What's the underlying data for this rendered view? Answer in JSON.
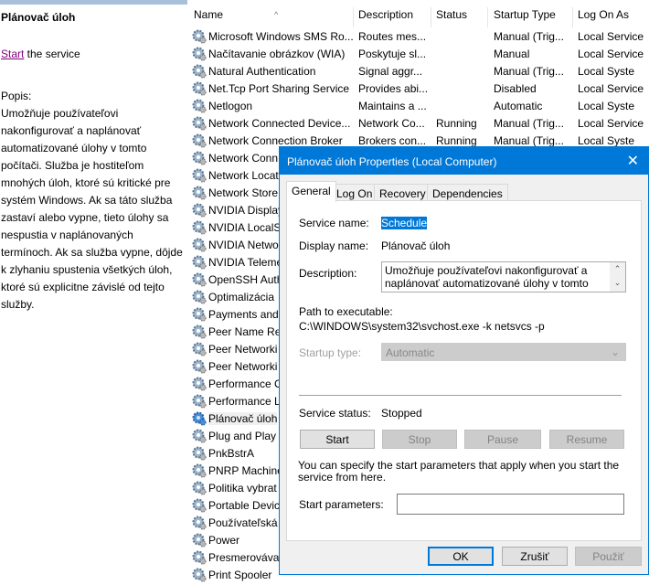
{
  "left_pane": {
    "title": "Plánovač úloh",
    "start_link": "Start",
    "start_rest": " the service",
    "popis_label": "Popis:",
    "description": "Umožňuje používateľovi nakonfigurovať a naplánovať automatizované úlohy v tomto počítači. Služba je hostiteľom mnohých úloh, ktoré sú kritické pre systém Windows. Ak sa táto služba zastaví alebo vypne, tieto úlohy sa nespustia v naplánovaných termínoch. Ak sa služba vypne, dôjde k zlyhaniu spustenia všetkých úloh, ktoré sú explicitne závislé od tejto služby."
  },
  "columns": [
    "Name",
    "Description",
    "Status",
    "Startup Type",
    "Log On As"
  ],
  "services": [
    {
      "name": "Microsoft Windows SMS Ro...",
      "desc": "Routes mes...",
      "status": "",
      "startup": "Manual (Trig...",
      "logon": "Local Service"
    },
    {
      "name": "Načítavanie obrázkov (WIA)",
      "desc": "Poskytuje sl...",
      "status": "",
      "startup": "Manual",
      "logon": "Local Service"
    },
    {
      "name": "Natural Authentication",
      "desc": "Signal aggr...",
      "status": "",
      "startup": "Manual (Trig...",
      "logon": "Local Syste"
    },
    {
      "name": "Net.Tcp Port Sharing Service",
      "desc": "Provides abi...",
      "status": "",
      "startup": "Disabled",
      "logon": "Local Service"
    },
    {
      "name": "Netlogon",
      "desc": "Maintains a ...",
      "status": "",
      "startup": "Automatic",
      "logon": "Local Syste"
    },
    {
      "name": "Network Connected Device...",
      "desc": "Network Co...",
      "status": "Running",
      "startup": "Manual (Trig...",
      "logon": "Local Service"
    },
    {
      "name": "Network Connection Broker",
      "desc": "Brokers con...",
      "status": "Running",
      "startup": "Manual (Trig...",
      "logon": "Local Syste"
    },
    {
      "name": "Network Conn"
    },
    {
      "name": "Network Locat"
    },
    {
      "name": "Network Store"
    },
    {
      "name": "NVIDIA Display"
    },
    {
      "name": "NVIDIA LocalS"
    },
    {
      "name": "NVIDIA Netwo"
    },
    {
      "name": "NVIDIA Teleme"
    },
    {
      "name": "OpenSSH Auth"
    },
    {
      "name": "Optimalizácia"
    },
    {
      "name": "Payments and"
    },
    {
      "name": "Peer Name Re"
    },
    {
      "name": "Peer Networki"
    },
    {
      "name": "Peer Networki"
    },
    {
      "name": "Performance C"
    },
    {
      "name": "Performance L"
    },
    {
      "name": "Plánovač úloh",
      "selected": true
    },
    {
      "name": "Plug and Play"
    },
    {
      "name": "PnkBstrA"
    },
    {
      "name": "PNRP Machine"
    },
    {
      "name": "Politika vybrat"
    },
    {
      "name": "Portable Devic"
    },
    {
      "name": "Používateľská"
    },
    {
      "name": "Power"
    },
    {
      "name": "Presmerováva"
    },
    {
      "name": "Print Spooler"
    }
  ],
  "dialog": {
    "title": "Plánovač úloh Properties (Local Computer)",
    "tabs": [
      "General",
      "Log On",
      "Recovery",
      "Dependencies"
    ],
    "service_name_label": "Service name:",
    "service_name": "Schedule",
    "display_name_label": "Display name:",
    "display_name": "Plánovač úloh",
    "description_label": "Description:",
    "description": "Umožňuje používateľovi nakonfigurovať a naplánovať automatizované úlohy v tomto počítači.",
    "path_label": "Path to executable:",
    "path": "C:\\WINDOWS\\system32\\svchost.exe -k netsvcs -p",
    "startup_label": "Startup type:",
    "startup_value": "Automatic",
    "status_label": "Service status:",
    "status_value": "Stopped",
    "btn_start": "Start",
    "btn_stop": "Stop",
    "btn_pause": "Pause",
    "btn_resume": "Resume",
    "hint": "You can specify the start parameters that apply when you start the service from here.",
    "params_label": "Start parameters:",
    "params_value": "",
    "ok": "OK",
    "cancel": "Zrušiť",
    "apply": "Použiť"
  },
  "colors": {
    "accent": "#0078d7"
  }
}
